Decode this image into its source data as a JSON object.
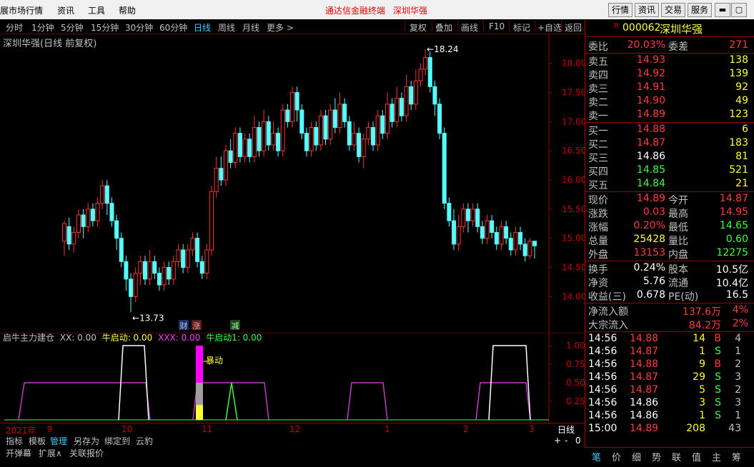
{
  "menu": {
    "items": [
      "展市场行情",
      "资讯",
      "工具",
      "帮助"
    ],
    "center": [
      "通达信金融终端",
      "深圳华强"
    ],
    "right_buttons": [
      "行情",
      "资讯",
      "交易",
      "服务"
    ]
  },
  "periods": [
    "分时",
    "1分钟",
    "5分钟",
    "15分钟",
    "30分钟",
    "60分钟",
    "日线",
    "周线",
    "月线",
    "更多 >"
  ],
  "tools": [
    "复权",
    "叠加",
    "画线",
    "F10",
    "标记",
    "+自选",
    "返回"
  ],
  "chart_title": "深圳华强(日线 前复权)",
  "price_axis": [
    "18.00",
    "17.50",
    "17.00",
    "16.50",
    "16.00",
    "15.50",
    "15.00",
    "14.50",
    "14.00"
  ],
  "annotations": {
    "high": "18.24",
    "low": "13.73"
  },
  "markers": [
    "财",
    "涨",
    "减"
  ],
  "indicator": {
    "name": "启牛主力建仓",
    "xx": "XX: 0.00",
    "qd": "牛启动: 0.00",
    "xxx": "XXX: 0.00",
    "qd1": "牛启动1: 0.00",
    "baodong": "暴动",
    "axis": [
      "1.00",
      "0.75",
      "0.50",
      "0.25"
    ]
  },
  "date_axis": [
    "2021年",
    "9",
    "10",
    "11",
    "12",
    "1",
    "2",
    "3"
  ],
  "period_label": "日线",
  "bottom_tabs": [
    "指标",
    "模板",
    "管理",
    "另存为",
    "绑定到",
    "云豹"
  ],
  "bottom_tabs2": [
    "开弹幕",
    "扩展∧",
    "关联报价"
  ],
  "zoom": [
    "+",
    "-",
    "0"
  ],
  "stock": {
    "code": "000062",
    "name": "深圳华强",
    "badge": "R"
  },
  "quote": {
    "weibi": [
      "委比",
      "20.03%",
      "委差",
      "271"
    ],
    "sells": [
      [
        "卖五",
        "14.93",
        "138"
      ],
      [
        "卖四",
        "14.92",
        "139"
      ],
      [
        "卖三",
        "14.91",
        "92"
      ],
      [
        "卖二",
        "14.90",
        "49"
      ],
      [
        "卖一",
        "14.89",
        "123"
      ]
    ],
    "buys": [
      [
        "买一",
        "14.88",
        "6"
      ],
      [
        "买二",
        "14.87",
        "183"
      ],
      [
        "买三",
        "14.86",
        "81"
      ],
      [
        "买四",
        "14.85",
        "521"
      ],
      [
        "买五",
        "14.84",
        "21"
      ]
    ],
    "stats": [
      [
        "现价",
        "14.89",
        "今开",
        "14.87"
      ],
      [
        "涨跌",
        "0.03",
        "最高",
        "14.95"
      ],
      [
        "涨幅",
        "0.20%",
        "最低",
        "14.65"
      ],
      [
        "总量",
        "25428",
        "量比",
        "0.60"
      ],
      [
        "外盘",
        "13153",
        "内盘",
        "12275"
      ]
    ],
    "stats2": [
      [
        "换手",
        "0.24%",
        "股本",
        "10.5亿"
      ],
      [
        "净资",
        "5.76",
        "流通",
        "10.4亿"
      ],
      [
        "收益(三)",
        "0.678",
        "PE(动)",
        "16.5"
      ]
    ],
    "flows": [
      [
        "净流入额",
        "137.6万",
        "4%"
      ],
      [
        "大宗流入",
        "84.2万",
        "2%"
      ]
    ],
    "ticks": [
      [
        "14:56",
        "14.88",
        "14",
        "B",
        "4"
      ],
      [
        "14:56",
        "14.87",
        "1",
        "S",
        "1"
      ],
      [
        "14:56",
        "14.88",
        "9",
        "B",
        "2"
      ],
      [
        "14:56",
        "14.87",
        "29",
        "S",
        "3"
      ],
      [
        "14:56",
        "14.87",
        "5",
        "S",
        "2"
      ],
      [
        "14:56",
        "14.86",
        "3",
        "S",
        "3"
      ],
      [
        "14:56",
        "14.86",
        "1",
        "S",
        "1"
      ],
      [
        "15:00",
        "14.89",
        "208",
        "",
        "43"
      ]
    ]
  },
  "right_tabs": [
    "笔",
    "价",
    "细",
    "势",
    "联",
    "值",
    "主",
    "筹"
  ],
  "chart_data": {
    "type": "candlestick",
    "title": "深圳华强(日线 前复权)",
    "ylim": [
      13.6,
      18.4
    ],
    "high_label": 18.24,
    "low_label": 13.73,
    "candles": [
      [
        14.95,
        15.25,
        15.3,
        14.7
      ],
      [
        15.2,
        14.9,
        15.35,
        14.8
      ],
      [
        14.9,
        15.1,
        15.2,
        14.75
      ],
      [
        15.1,
        15.4,
        15.5,
        15.0
      ],
      [
        15.4,
        15.2,
        15.5,
        15.0
      ],
      [
        15.2,
        15.5,
        15.6,
        15.1
      ],
      [
        15.5,
        15.3,
        15.6,
        15.2
      ],
      [
        15.3,
        15.6,
        15.7,
        15.2
      ],
      [
        15.6,
        15.9,
        16.0,
        15.5
      ],
      [
        15.9,
        15.6,
        16.0,
        15.4
      ],
      [
        15.6,
        15.3,
        15.7,
        15.2
      ],
      [
        15.3,
        15.0,
        15.4,
        14.8
      ],
      [
        15.0,
        14.6,
        15.1,
        14.5
      ],
      [
        14.6,
        14.3,
        14.7,
        14.1
      ],
      [
        14.3,
        14.0,
        14.4,
        13.73
      ],
      [
        14.0,
        14.4,
        14.5,
        13.9
      ],
      [
        14.4,
        14.6,
        14.7,
        14.2
      ],
      [
        14.6,
        14.3,
        14.7,
        14.2
      ],
      [
        14.3,
        14.6,
        14.8,
        14.2
      ],
      [
        14.6,
        14.4,
        14.7,
        14.3
      ],
      [
        14.4,
        14.2,
        14.5,
        14.1
      ],
      [
        14.2,
        14.5,
        14.6,
        14.1
      ],
      [
        14.5,
        14.3,
        14.6,
        14.2
      ],
      [
        14.3,
        14.6,
        14.7,
        14.2
      ],
      [
        14.6,
        14.8,
        14.9,
        14.5
      ],
      [
        14.8,
        14.5,
        14.9,
        14.4
      ],
      [
        14.5,
        14.8,
        14.9,
        14.4
      ],
      [
        14.8,
        15.0,
        15.1,
        14.7
      ],
      [
        15.0,
        14.6,
        15.1,
        14.5
      ],
      [
        14.6,
        14.4,
        14.7,
        14.3
      ],
      [
        14.4,
        14.8,
        14.9,
        14.3
      ],
      [
        14.8,
        15.8,
        15.9,
        14.7
      ],
      [
        15.8,
        16.2,
        16.4,
        15.7
      ],
      [
        16.2,
        16.0,
        16.4,
        15.9
      ],
      [
        16.0,
        16.5,
        16.6,
        15.9
      ],
      [
        16.5,
        16.3,
        16.7,
        16.2
      ],
      [
        16.3,
        16.8,
        16.9,
        16.2
      ],
      [
        16.8,
        16.4,
        16.9,
        16.3
      ],
      [
        16.4,
        16.7,
        16.8,
        16.3
      ],
      [
        16.7,
        16.4,
        16.8,
        16.3
      ],
      [
        16.4,
        16.9,
        17.1,
        16.3
      ],
      [
        16.9,
        16.5,
        17.0,
        16.4
      ],
      [
        16.5,
        17.0,
        17.2,
        16.4
      ],
      [
        17.0,
        16.6,
        17.1,
        16.5
      ],
      [
        16.6,
        16.8,
        17.0,
        16.5
      ],
      [
        16.8,
        16.5,
        16.9,
        16.4
      ],
      [
        16.5,
        17.2,
        17.3,
        16.4
      ],
      [
        17.2,
        17.0,
        17.3,
        16.9
      ],
      [
        17.0,
        17.5,
        17.6,
        16.9
      ],
      [
        17.5,
        17.2,
        17.6,
        17.0
      ],
      [
        17.2,
        16.8,
        17.3,
        16.7
      ],
      [
        16.8,
        16.5,
        16.9,
        16.4
      ],
      [
        16.5,
        16.9,
        17.0,
        16.4
      ],
      [
        16.9,
        16.6,
        17.0,
        16.5
      ],
      [
        16.6,
        17.1,
        17.2,
        16.5
      ],
      [
        17.1,
        16.7,
        17.2,
        16.6
      ],
      [
        16.7,
        17.2,
        17.3,
        16.6
      ],
      [
        17.2,
        16.9,
        17.4,
        16.8
      ],
      [
        16.9,
        17.3,
        17.5,
        16.8
      ],
      [
        17.3,
        17.0,
        17.4,
        16.9
      ],
      [
        17.0,
        16.6,
        17.1,
        16.5
      ],
      [
        16.6,
        16.8,
        17.0,
        16.5
      ],
      [
        16.8,
        16.4,
        16.9,
        16.3
      ],
      [
        16.4,
        16.7,
        16.8,
        16.2
      ],
      [
        16.7,
        16.9,
        17.0,
        16.6
      ],
      [
        16.9,
        16.6,
        17.0,
        16.5
      ],
      [
        16.6,
        17.1,
        17.2,
        16.5
      ],
      [
        17.1,
        16.8,
        17.2,
        16.7
      ],
      [
        16.8,
        17.3,
        17.5,
        16.7
      ],
      [
        17.3,
        17.0,
        17.4,
        16.9
      ],
      [
        17.0,
        17.4,
        17.6,
        16.9
      ],
      [
        17.4,
        17.1,
        17.5,
        17.0
      ],
      [
        17.1,
        17.6,
        17.8,
        17.0
      ],
      [
        17.6,
        17.3,
        17.7,
        17.2
      ],
      [
        17.3,
        17.7,
        17.9,
        17.2
      ],
      [
        17.7,
        17.9,
        18.0,
        17.6
      ],
      [
        17.9,
        18.1,
        18.24,
        17.8
      ],
      [
        18.1,
        17.6,
        18.2,
        17.5
      ],
      [
        17.6,
        17.3,
        17.7,
        17.1
      ],
      [
        17.3,
        16.8,
        17.4,
        16.7
      ],
      [
        16.8,
        15.6,
        16.9,
        15.5
      ],
      [
        15.6,
        15.3,
        15.7,
        15.2
      ],
      [
        15.3,
        14.9,
        15.5,
        14.8
      ],
      [
        14.9,
        15.2,
        15.4,
        14.8
      ],
      [
        15.2,
        15.5,
        15.6,
        15.1
      ],
      [
        15.5,
        15.3,
        15.6,
        15.1
      ],
      [
        15.3,
        15.5,
        15.6,
        15.2
      ],
      [
        15.5,
        15.2,
        15.6,
        15.1
      ],
      [
        15.2,
        15.0,
        15.3,
        14.9
      ],
      [
        15.0,
        15.3,
        15.4,
        14.9
      ],
      [
        15.3,
        15.1,
        15.4,
        15.0
      ],
      [
        15.1,
        14.9,
        15.2,
        14.8
      ],
      [
        14.9,
        15.2,
        15.3,
        14.8
      ],
      [
        15.2,
        15.0,
        15.3,
        14.9
      ],
      [
        15.0,
        14.8,
        15.1,
        14.7
      ],
      [
        14.8,
        15.1,
        15.2,
        14.7
      ],
      [
        15.1,
        14.9,
        15.2,
        14.8
      ],
      [
        14.9,
        14.7,
        15.0,
        14.6
      ],
      [
        14.7,
        14.95,
        15.0,
        14.65
      ],
      [
        14.95,
        14.87,
        14.95,
        14.65
      ]
    ]
  }
}
